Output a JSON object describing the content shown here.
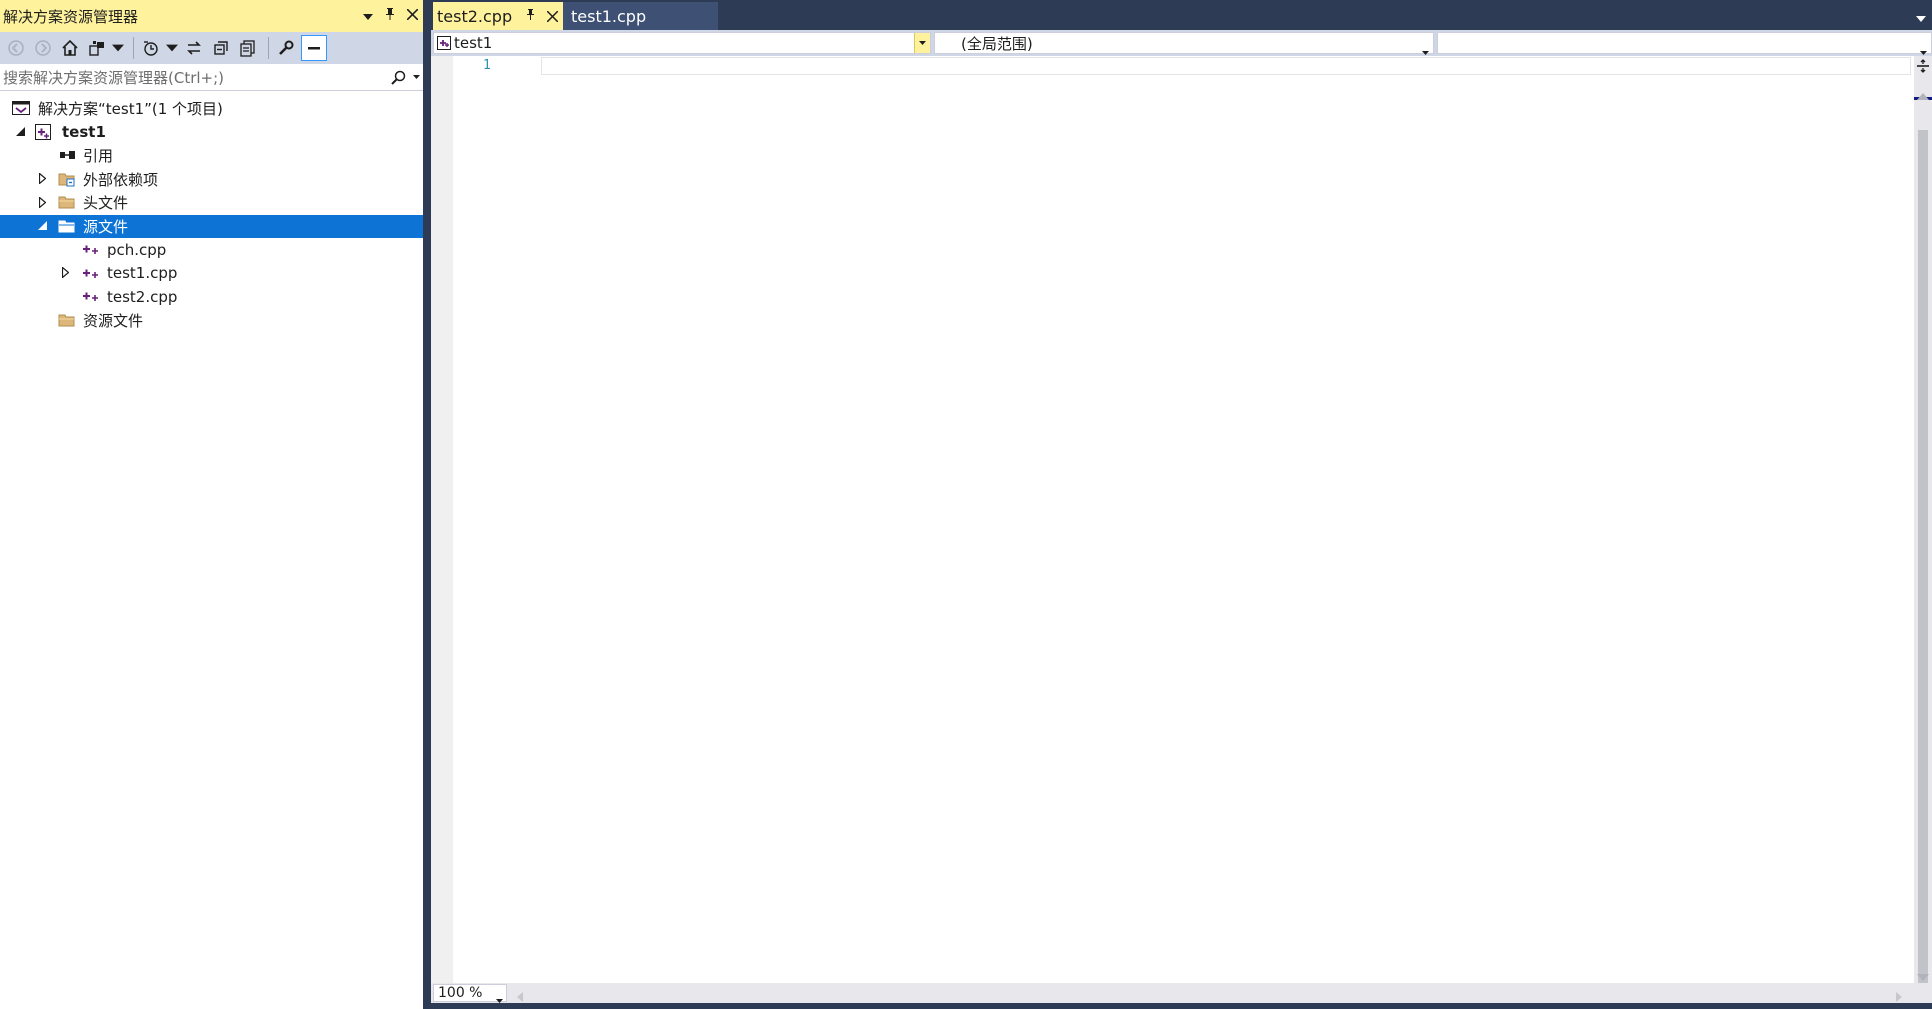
{
  "solution_explorer": {
    "title": "解决方案资源管理器",
    "title_buttons": [
      "dropdown",
      "pin",
      "close"
    ],
    "search_placeholder": "搜索解决方案资源管理器(Ctrl+;)",
    "tree": [
      {
        "label": "解决方案“test1”(1 个项目)",
        "icon": "solution-icon",
        "level": 0,
        "expander": "none"
      },
      {
        "label": "test1",
        "icon": "cpp-project-icon",
        "level": 1,
        "expander": "expanded",
        "bold": true
      },
      {
        "label": "引用",
        "icon": "references-icon",
        "level": 2,
        "expander": "none"
      },
      {
        "label": "外部依赖项",
        "icon": "external-deps-icon",
        "level": 2,
        "expander": "collapsed"
      },
      {
        "label": "头文件",
        "icon": "folder-icon",
        "level": 2,
        "expander": "collapsed"
      },
      {
        "label": "源文件",
        "icon": "folder-icon",
        "level": 2,
        "expander": "expanded",
        "selected": true
      },
      {
        "label": "pch.cpp",
        "icon": "cpp-file-icon",
        "level": 3,
        "expander": "none"
      },
      {
        "label": "test1.cpp",
        "icon": "cpp-file-icon",
        "level": 3,
        "expander": "collapsed"
      },
      {
        "label": "test2.cpp",
        "icon": "cpp-file-icon",
        "level": 3,
        "expander": "none"
      },
      {
        "label": "资源文件",
        "icon": "folder-icon",
        "level": 2,
        "expander": "none"
      }
    ]
  },
  "tabs": [
    {
      "label": "test2.cpp",
      "active": true
    },
    {
      "label": "test1.cpp",
      "active": false
    }
  ],
  "navbar": {
    "project": "test1",
    "scope": "(全局范围)",
    "member": ""
  },
  "editor": {
    "line_numbers": [
      "1"
    ]
  },
  "statusbar": {
    "zoom": "100 %"
  },
  "colors": {
    "chrome": "#2d3b55",
    "tab_active": "#fff29d",
    "selection": "#0d74d6",
    "toolbar": "#cfd6e5",
    "line_number": "#2b91af"
  }
}
